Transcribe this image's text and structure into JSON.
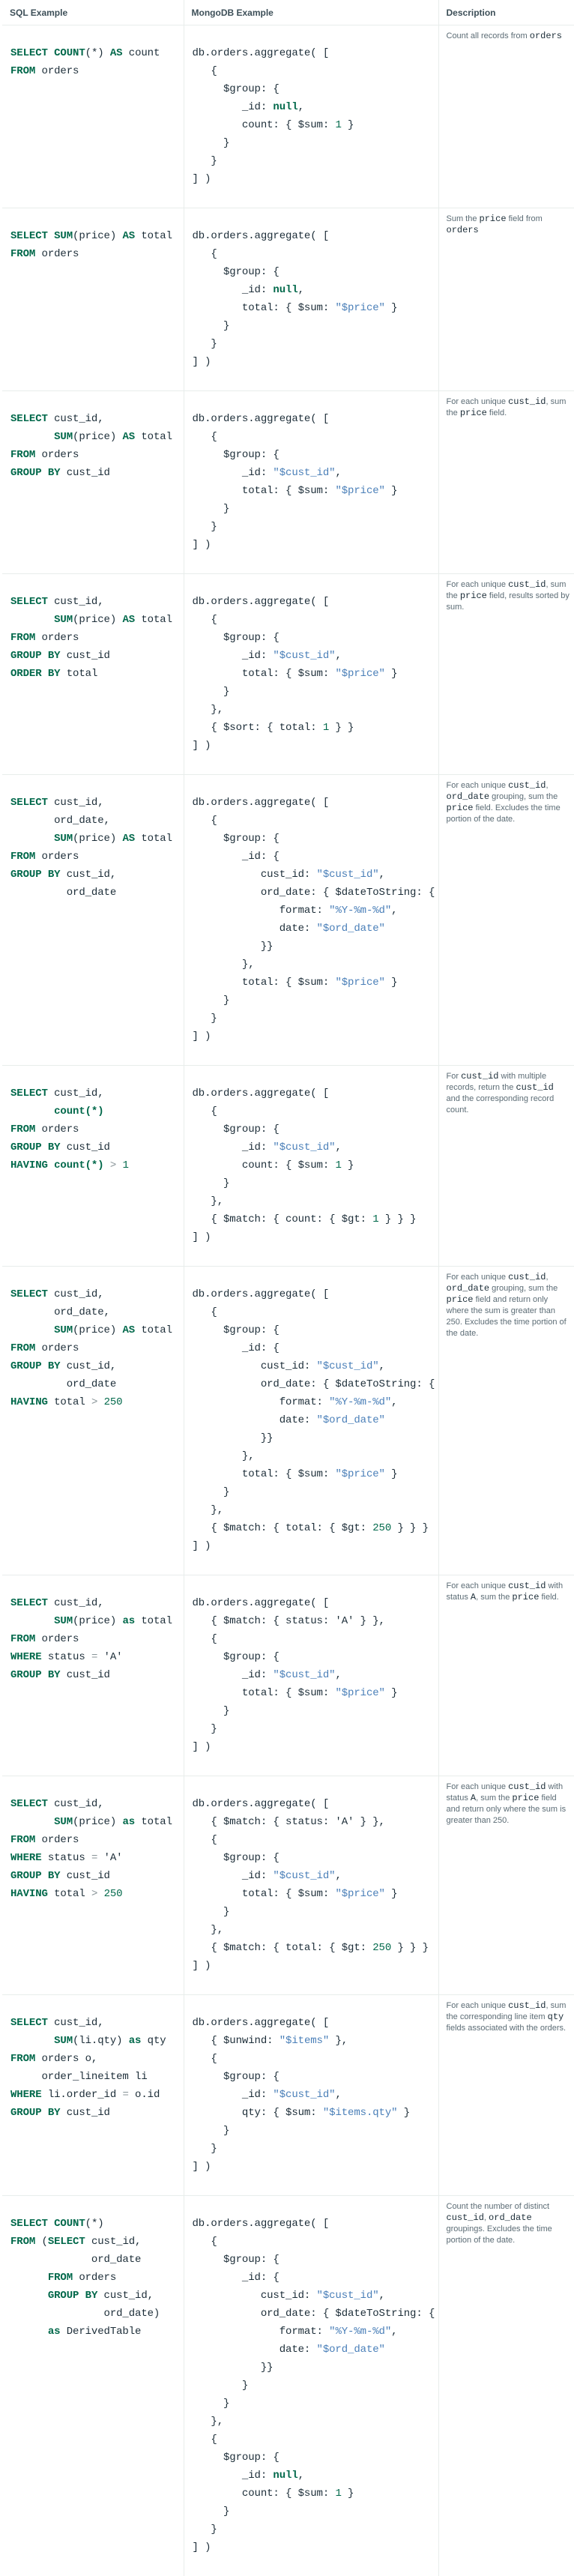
{
  "headers": {
    "sql": "SQL Example",
    "mongo": "MongoDB Example",
    "desc": "Description"
  },
  "rows": [
    {
      "sql": [
        "SELECT COUNT(*) AS count",
        "FROM orders"
      ],
      "mongo": [
        "db.orders.aggregate( [",
        "   {",
        "     $group: {",
        "        _id: null,",
        "        count: { $sum: 1 }",
        "     }",
        "   }",
        "] )"
      ],
      "desc": [
        {
          "t": "Count all records from "
        },
        {
          "t": "orders",
          "c": true
        }
      ]
    },
    {
      "sql": [
        "SELECT SUM(price) AS total",
        "FROM orders"
      ],
      "mongo": [
        "db.orders.aggregate( [",
        "   {",
        "     $group: {",
        "        _id: null,",
        "        total: { $sum: \"$price\" }",
        "     }",
        "   }",
        "] )"
      ],
      "desc": [
        {
          "t": "Sum the "
        },
        {
          "t": "price",
          "c": true
        },
        {
          "t": " field from "
        },
        {
          "t": "orders",
          "c": true
        }
      ]
    },
    {
      "sql": [
        "SELECT cust_id,",
        "       SUM(price) AS total",
        "FROM orders",
        "GROUP BY cust_id"
      ],
      "mongo": [
        "db.orders.aggregate( [",
        "   {",
        "     $group: {",
        "        _id: \"$cust_id\",",
        "        total: { $sum: \"$price\" }",
        "     }",
        "   }",
        "] )"
      ],
      "desc": [
        {
          "t": "For each unique "
        },
        {
          "t": "cust_id",
          "c": true
        },
        {
          "t": ", sum the "
        },
        {
          "t": "price",
          "c": true
        },
        {
          "t": " field."
        }
      ]
    },
    {
      "sql": [
        "SELECT cust_id,",
        "       SUM(price) AS total",
        "FROM orders",
        "GROUP BY cust_id",
        "ORDER BY total"
      ],
      "mongo": [
        "db.orders.aggregate( [",
        "   {",
        "     $group: {",
        "        _id: \"$cust_id\",",
        "        total: { $sum: \"$price\" }",
        "     }",
        "   },",
        "   { $sort: { total: 1 } }",
        "] )"
      ],
      "desc": [
        {
          "t": "For each unique "
        },
        {
          "t": "cust_id",
          "c": true
        },
        {
          "t": ", sum the "
        },
        {
          "t": "price",
          "c": true
        },
        {
          "t": " field, results sorted by sum."
        }
      ]
    },
    {
      "sql": [
        "SELECT cust_id,",
        "       ord_date,",
        "       SUM(price) AS total",
        "FROM orders",
        "GROUP BY cust_id,",
        "         ord_date"
      ],
      "mongo": [
        "db.orders.aggregate( [",
        "   {",
        "     $group: {",
        "        _id: {",
        "           cust_id: \"$cust_id\",",
        "           ord_date: { $dateToString: {",
        "              format: \"%Y-%m-%d\",",
        "              date: \"$ord_date\"",
        "           }}",
        "        },",
        "        total: { $sum: \"$price\" }",
        "     }",
        "   }",
        "] )"
      ],
      "desc": [
        {
          "t": "For each unique "
        },
        {
          "t": "cust_id",
          "c": true
        },
        {
          "t": ", "
        },
        {
          "t": "ord_date",
          "c": true
        },
        {
          "t": " grouping, sum the "
        },
        {
          "t": "price",
          "c": true
        },
        {
          "t": " field. Excludes the time portion of the date."
        }
      ]
    },
    {
      "sql": [
        "SELECT cust_id,",
        "       count(*)",
        "FROM orders",
        "GROUP BY cust_id",
        "HAVING count(*) > 1"
      ],
      "mongo": [
        "db.orders.aggregate( [",
        "   {",
        "     $group: {",
        "        _id: \"$cust_id\",",
        "        count: { $sum: 1 }",
        "     }",
        "   },",
        "   { $match: { count: { $gt: 1 } } }",
        "] )"
      ],
      "desc": [
        {
          "t": "For "
        },
        {
          "t": "cust_id",
          "c": true
        },
        {
          "t": " with multiple records, return the "
        },
        {
          "t": "cust_id",
          "c": true
        },
        {
          "t": " and the corresponding record count."
        }
      ]
    },
    {
      "sql": [
        "SELECT cust_id,",
        "       ord_date,",
        "       SUM(price) AS total",
        "FROM orders",
        "GROUP BY cust_id,",
        "         ord_date",
        "HAVING total > 250"
      ],
      "mongo": [
        "db.orders.aggregate( [",
        "   {",
        "     $group: {",
        "        _id: {",
        "           cust_id: \"$cust_id\",",
        "           ord_date: { $dateToString: {",
        "              format: \"%Y-%m-%d\",",
        "              date: \"$ord_date\"",
        "           }}",
        "        },",
        "        total: { $sum: \"$price\" }",
        "     }",
        "   },",
        "   { $match: { total: { $gt: 250 } } }",
        "] )"
      ],
      "desc": [
        {
          "t": "For each unique "
        },
        {
          "t": "cust_id",
          "c": true
        },
        {
          "t": ", "
        },
        {
          "t": "ord_date",
          "c": true
        },
        {
          "t": " grouping, sum the "
        },
        {
          "t": "price",
          "c": true
        },
        {
          "t": " field and return only where the sum is greater than 250. Excludes the time portion of the date."
        }
      ]
    },
    {
      "sql": [
        "SELECT cust_id,",
        "       SUM(price) as total",
        "FROM orders",
        "WHERE status = 'A'",
        "GROUP BY cust_id"
      ],
      "mongo": [
        "db.orders.aggregate( [",
        "   { $match: { status: 'A' } },",
        "   {",
        "     $group: {",
        "        _id: \"$cust_id\",",
        "        total: { $sum: \"$price\" }",
        "     }",
        "   }",
        "] )"
      ],
      "desc": [
        {
          "t": "For each unique "
        },
        {
          "t": "cust_id",
          "c": true
        },
        {
          "t": " with status "
        },
        {
          "t": "A",
          "c": true
        },
        {
          "t": ", sum the "
        },
        {
          "t": "price",
          "c": true
        },
        {
          "t": " field."
        }
      ]
    },
    {
      "sql": [
        "SELECT cust_id,",
        "       SUM(price) as total",
        "FROM orders",
        "WHERE status = 'A'",
        "GROUP BY cust_id",
        "HAVING total > 250"
      ],
      "mongo": [
        "db.orders.aggregate( [",
        "   { $match: { status: 'A' } },",
        "   {",
        "     $group: {",
        "        _id: \"$cust_id\",",
        "        total: { $sum: \"$price\" }",
        "     }",
        "   },",
        "   { $match: { total: { $gt: 250 } } }",
        "] )"
      ],
      "desc": [
        {
          "t": "For each unique "
        },
        {
          "t": "cust_id",
          "c": true
        },
        {
          "t": " with status "
        },
        {
          "t": "A",
          "c": true
        },
        {
          "t": ", sum the "
        },
        {
          "t": "price",
          "c": true
        },
        {
          "t": " field and return only where the sum is greater than 250."
        }
      ]
    },
    {
      "sql": [
        "SELECT cust_id,",
        "       SUM(li.qty) as qty",
        "FROM orders o,",
        "     order_lineitem li",
        "WHERE li.order_id = o.id",
        "GROUP BY cust_id"
      ],
      "mongo": [
        "db.orders.aggregate( [",
        "   { $unwind: \"$items\" },",
        "   {",
        "     $group: {",
        "        _id: \"$cust_id\",",
        "        qty: { $sum: \"$items.qty\" }",
        "     }",
        "   }",
        "] )"
      ],
      "desc": [
        {
          "t": "For each unique "
        },
        {
          "t": "cust_id",
          "c": true
        },
        {
          "t": ", sum the corresponding line item "
        },
        {
          "t": "qty",
          "c": true
        },
        {
          "t": " fields associated with the orders."
        }
      ]
    },
    {
      "sql": [
        "SELECT COUNT(*)",
        "FROM (SELECT cust_id,",
        "             ord_date",
        "      FROM orders",
        "      GROUP BY cust_id,",
        "               ord_date)",
        "      as DerivedTable"
      ],
      "mongo": [
        "db.orders.aggregate( [",
        "   {",
        "     $group: {",
        "        _id: {",
        "           cust_id: \"$cust_id\",",
        "           ord_date: { $dateToString: {",
        "              format: \"%Y-%m-%d\",",
        "              date: \"$ord_date\"",
        "           }}",
        "        }",
        "     }",
        "   },",
        "   {",
        "     $group: {",
        "        _id: null,",
        "        count: { $sum: 1 }",
        "     }",
        "   }",
        "] )"
      ],
      "desc": [
        {
          "t": "Count the number of distinct "
        },
        {
          "t": "cust_id",
          "c": true
        },
        {
          "t": ", "
        },
        {
          "t": "ord_date",
          "c": true
        },
        {
          "t": " groupings. Excludes the time portion of the date."
        }
      ]
    }
  ]
}
